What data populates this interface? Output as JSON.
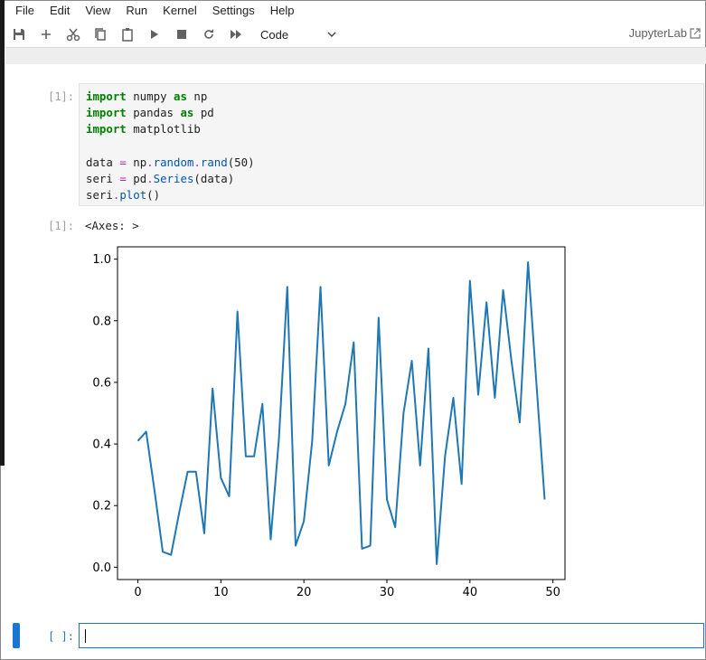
{
  "menu": [
    "File",
    "Edit",
    "View",
    "Run",
    "Kernel",
    "Settings",
    "Help"
  ],
  "toolbar": {
    "icons": [
      "save-icon",
      "add-icon",
      "cut-icon",
      "copy-icon",
      "paste-icon",
      "run-icon",
      "stop-icon",
      "restart-icon",
      "fast-forward-icon"
    ],
    "cell_type": "Code",
    "jupyterlab_label": "JupyterLab"
  },
  "cells": {
    "input_prompt": "[1]:",
    "output_prompt": "[1]:",
    "output_text": "<Axes: >",
    "empty_prompt": "[ ]:"
  },
  "chart_data": {
    "type": "line",
    "title": "",
    "xlabel": "",
    "ylabel": "",
    "xlim": [
      -2.45,
      51.45
    ],
    "ylim": [
      -0.04,
      1.04
    ],
    "xticks": [
      0,
      10,
      20,
      30,
      40,
      50
    ],
    "yticks": [
      0.0,
      0.2,
      0.4,
      0.6,
      0.8,
      1.0
    ],
    "xtick_labels": [
      "0",
      "10",
      "20",
      "30",
      "40",
      "50"
    ],
    "ytick_labels": [
      "0.0",
      "0.2",
      "0.4",
      "0.6",
      "0.8",
      "1.0"
    ],
    "color": "#1f77b4",
    "x": [
      0,
      1,
      2,
      3,
      4,
      5,
      6,
      7,
      8,
      9,
      10,
      11,
      12,
      13,
      14,
      15,
      16,
      17,
      18,
      19,
      20,
      21,
      22,
      23,
      24,
      25,
      26,
      27,
      28,
      29,
      30,
      31,
      32,
      33,
      34,
      35,
      36,
      37,
      38,
      39,
      40,
      41,
      42,
      43,
      44,
      45,
      46,
      47,
      48,
      49
    ],
    "values": [
      0.41,
      0.44,
      0.25,
      0.05,
      0.04,
      0.18,
      0.31,
      0.31,
      0.11,
      0.58,
      0.29,
      0.23,
      0.83,
      0.36,
      0.36,
      0.53,
      0.09,
      0.42,
      0.91,
      0.07,
      0.15,
      0.41,
      0.91,
      0.33,
      0.44,
      0.53,
      0.73,
      0.06,
      0.07,
      0.81,
      0.22,
      0.13,
      0.5,
      0.67,
      0.33,
      0.71,
      0.01,
      0.36,
      0.55,
      0.27,
      0.93,
      0.56,
      0.86,
      0.55,
      0.9,
      0.67,
      0.47,
      0.99,
      0.6,
      0.22
    ]
  }
}
